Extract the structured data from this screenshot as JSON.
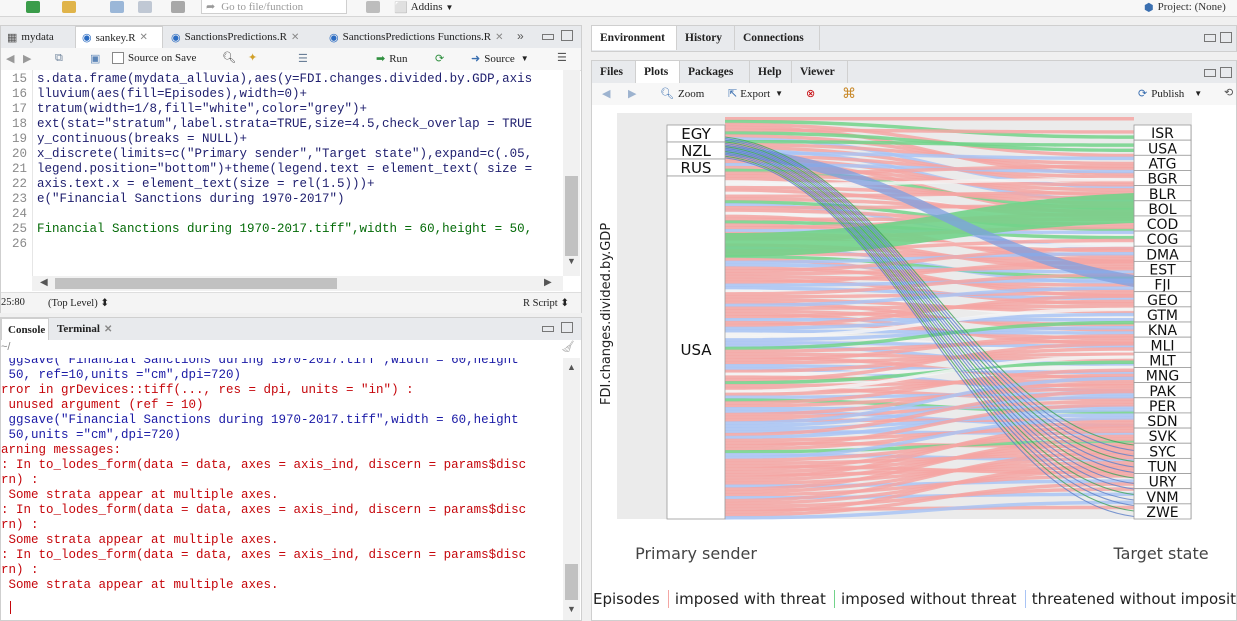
{
  "toolbar": {
    "goto_placeholder": "Go to file/function",
    "addins_label": "Addins",
    "project_label": "Project: (None)"
  },
  "source_pane": {
    "tabs": [
      {
        "label": "mydata"
      },
      {
        "label": "sankey.R"
      },
      {
        "label": "SanctionsPredictions.R"
      },
      {
        "label": "SanctionsPredictions Functions.R"
      }
    ],
    "source_on_save_label": "Source on Save",
    "run_label": "Run",
    "source_label": "Source",
    "code_lines": [
      {
        "n": "15",
        "text": "s.data.frame(mydata_alluvia),aes(y=FDI.changes.divided.by.GDP,axis"
      },
      {
        "n": "16",
        "text": "lluvium(aes(fill=Episodes),width=0)+"
      },
      {
        "n": "17",
        "text": "tratum(width=1/8,fill=\"white\",color=\"grey\")+"
      },
      {
        "n": "18",
        "text": "ext(stat=\"stratum\",label.strata=TRUE,size=4.5,check_overlap = TRUE"
      },
      {
        "n": "19",
        "text": "y_continuous(breaks = NULL)+"
      },
      {
        "n": "20",
        "text": "x_discrete(limits=c(\"Primary sender\",\"Target state\"),expand=c(.05,"
      },
      {
        "n": "21",
        "text": "legend.position=\"bottom\")+theme(legend.text = element_text( size ="
      },
      {
        "n": "22",
        "text": "axis.text.x = element_text(size = rel(1.5)))+"
      },
      {
        "n": "23",
        "text": "e(\"Financial Sanctions during 1970-2017\")"
      },
      {
        "n": "24",
        "text": ""
      },
      {
        "n": "25",
        "text": "Financial Sanctions during 1970-2017.tiff\",width = 60,height = 50,"
      },
      {
        "n": "26",
        "text": ""
      }
    ],
    "cursor_pos": "25:80",
    "scope": "(Top Level)",
    "file_type": "R Script"
  },
  "console_pane": {
    "tabs": [
      {
        "label": "Console"
      },
      {
        "label": "Terminal"
      }
    ],
    "lines": [
      {
        "text": " ggsave(\"Financial Sanctions during 1970-2017.tiff\",width = 60,height",
        "color": "blue"
      },
      {
        "text": " 50, ref=10,units =\"cm\",dpi=720)",
        "color": "blue"
      },
      {
        "text": "rror in grDevices::tiff(..., res = dpi, units = \"in\") :",
        "color": "red"
      },
      {
        "text": " unused argument (ref = 10)",
        "color": "red"
      },
      {
        "text": " ggsave(\"Financial Sanctions during 1970-2017.tiff\",width = 60,height",
        "color": "blue"
      },
      {
        "text": " 50,units =\"cm\",dpi=720)",
        "color": "blue"
      },
      {
        "text": "arning messages:",
        "color": "red"
      },
      {
        "text": ": In to_lodes_form(data = data, axes = axis_ind, discern = params$disc",
        "color": "red"
      },
      {
        "text": "rn) :",
        "color": "red"
      },
      {
        "text": " Some strata appear at multiple axes.",
        "color": "red"
      },
      {
        "text": ": In to_lodes_form(data = data, axes = axis_ind, discern = params$disc",
        "color": "red"
      },
      {
        "text": "rn) :",
        "color": "red"
      },
      {
        "text": " Some strata appear at multiple axes.",
        "color": "red"
      },
      {
        "text": ": In to_lodes_form(data = data, axes = axis_ind, discern = params$disc",
        "color": "red"
      },
      {
        "text": "rn) :",
        "color": "red"
      },
      {
        "text": " Some strata appear at multiple axes.",
        "color": "red"
      }
    ]
  },
  "env_pane": {
    "tabs": [
      {
        "label": "Environment"
      },
      {
        "label": "History"
      },
      {
        "label": "Connections"
      }
    ]
  },
  "plots_pane": {
    "tabs": [
      {
        "label": "Files"
      },
      {
        "label": "Plots"
      },
      {
        "label": "Packages"
      },
      {
        "label": "Help"
      },
      {
        "label": "Viewer"
      }
    ],
    "zoom_label": "Zoom",
    "export_label": "Export",
    "publish_label": "Publish"
  },
  "chart_data": {
    "type": "alluvial",
    "title": "",
    "ylabel": "FDI.changes.divided.by.GDP",
    "axes": [
      "Primary sender",
      "Target state"
    ],
    "sender_strata": [
      "EGY",
      "NZL",
      "RUS",
      "USA"
    ],
    "target_strata": [
      "ISR",
      "USA",
      "ATG",
      "BGR",
      "BLR",
      "BOL",
      "COD",
      "COG",
      "DMA",
      "EST",
      "FJI",
      "GEO",
      "GTM",
      "KNA",
      "MLI",
      "MLT",
      "MNG",
      "PAK",
      "PER",
      "SDN",
      "SVK",
      "SYC",
      "TUN",
      "URY",
      "VNM",
      "ZWE"
    ],
    "legend_title": "Episodes",
    "series": [
      {
        "name": "imposed with threat",
        "color": "#f4a6a3"
      },
      {
        "name": "imposed without threat",
        "color": "#72d38a"
      },
      {
        "name": "threatened without imposit",
        "color": "#a9c4f5"
      }
    ],
    "grid": true,
    "legend_position": "bottom"
  }
}
